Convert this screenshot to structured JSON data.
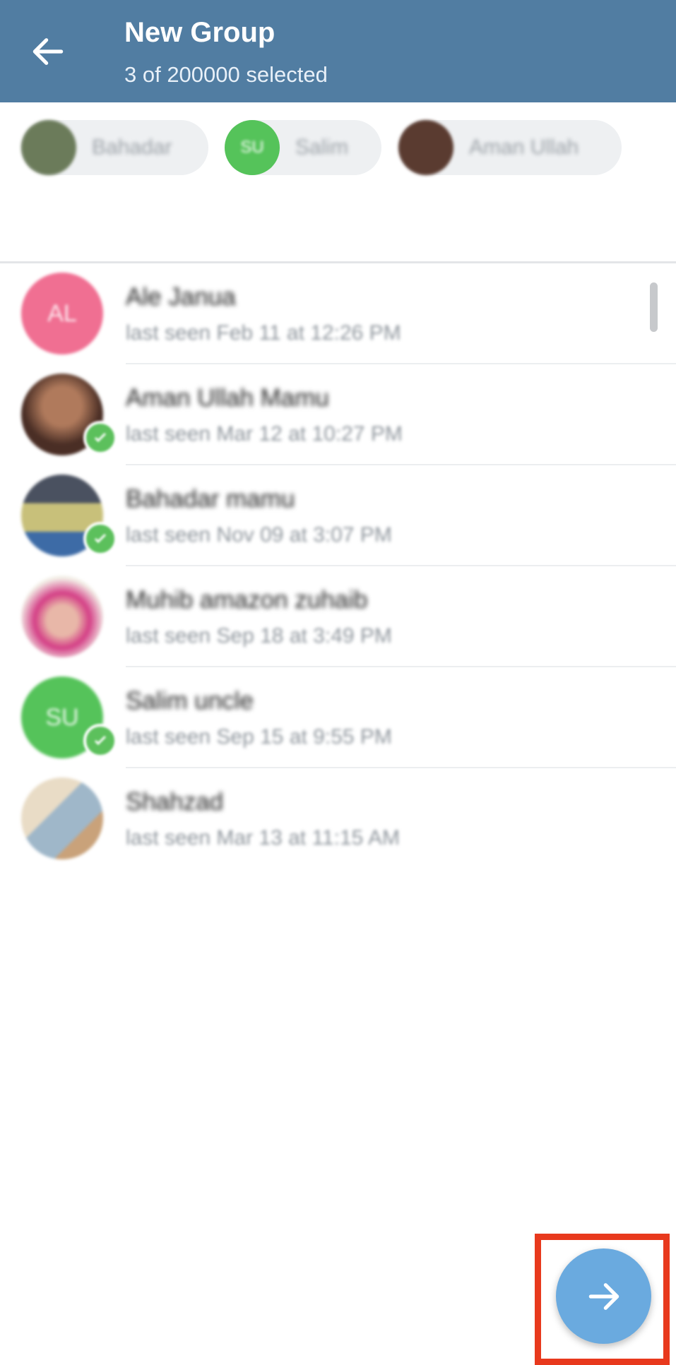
{
  "header": {
    "title": "New Group",
    "subtitle": "3 of 200000 selected",
    "back_icon": "arrow-left-icon",
    "background": "#517da2"
  },
  "selected_chips": [
    {
      "label": "Bahadar",
      "initials": "",
      "avatar_color": "#6b7b5a"
    },
    {
      "label": "Salim",
      "initials": "SU",
      "avatar_color": "#55c35a"
    },
    {
      "label": "Aman Ullah",
      "initials": "",
      "avatar_color": "#5a3b30"
    }
  ],
  "contacts": [
    {
      "name": "Ale Janua",
      "status": "last seen Feb 11 at 12:26 PM",
      "initials": "AL",
      "avatar_color": "#f06f92",
      "selected": false
    },
    {
      "name": "Aman Ullah Mamu",
      "status": "last seen Mar 12 at 10:27 PM",
      "initials": "",
      "avatar_color": "#5a3b30",
      "selected": true
    },
    {
      "name": "Bahadar mamu",
      "status": "last seen Nov 09 at 3:07 PM",
      "initials": "",
      "avatar_color": "#6b7b5a",
      "selected": true
    },
    {
      "name": "Muhib amazon zuhaib",
      "status": "last seen Sep 18 at 3:49 PM",
      "initials": "",
      "avatar_color": "#d87aa0",
      "selected": false
    },
    {
      "name": "Salim uncle",
      "status": "last seen Sep 15 at 9:55 PM",
      "initials": "SU",
      "avatar_color": "#55c35a",
      "selected": true
    },
    {
      "name": "Shahzad",
      "status": "last seen Mar 13 at 11:15 AM",
      "initials": "",
      "avatar_color": "#c9b79a",
      "selected": false
    }
  ],
  "fab": {
    "icon": "arrow-right-icon",
    "color": "#6aaadf",
    "highlight_color": "#e8391d"
  }
}
